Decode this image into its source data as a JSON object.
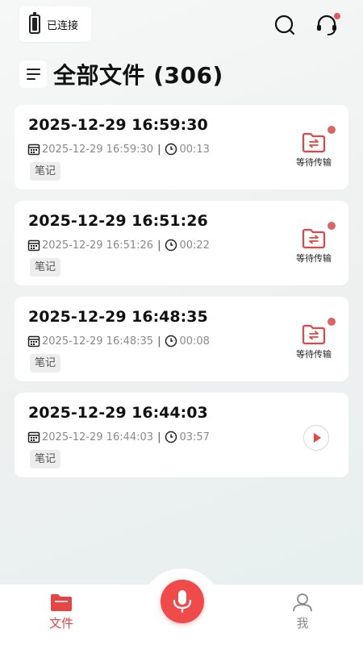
{
  "header": {
    "connection_label": "已连接",
    "title": "全部文件 (306)"
  },
  "files": [
    {
      "title": "2025-12-29 16:59:30",
      "date": "2025-12-29 16:59:30",
      "duration": "00:13",
      "tag": "笔记",
      "status": "等待传输"
    },
    {
      "title": "2025-12-29 16:51:26",
      "date": "2025-12-29 16:51:26",
      "duration": "00:22",
      "tag": "笔记",
      "status": "等待传输"
    },
    {
      "title": "2025-12-29 16:48:35",
      "date": "2025-12-29 16:48:35",
      "duration": "00:08",
      "tag": "笔记",
      "status": "等待传输"
    },
    {
      "title": "2025-12-29 16:44:03",
      "date": "2025-12-29 16:44:03",
      "duration": "03:57",
      "tag": "笔记",
      "status": ""
    }
  ],
  "separator": "|",
  "nav": {
    "files_label": "文件",
    "me_label": "我"
  },
  "colors": {
    "accent": "#e64545",
    "dot": "#d96666"
  }
}
